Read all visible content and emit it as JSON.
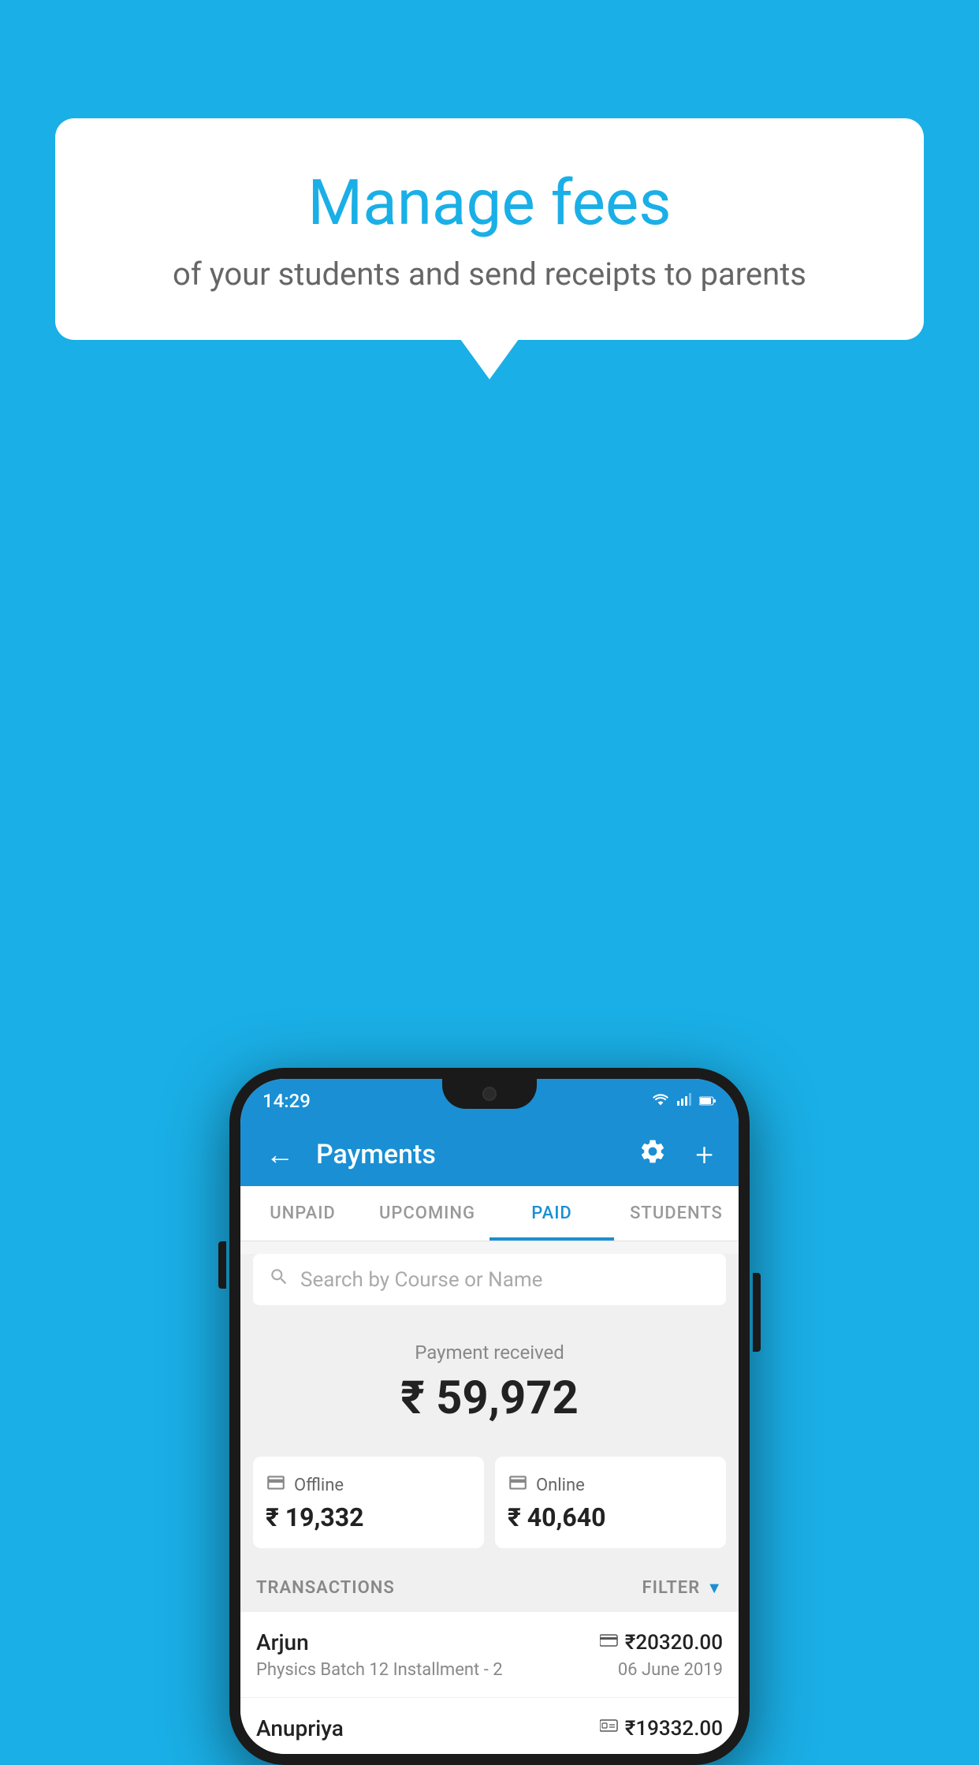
{
  "background_color": "#1AAFE6",
  "speech_bubble": {
    "title": "Manage fees",
    "subtitle": "of your students and send receipts to parents"
  },
  "status_bar": {
    "time": "14:29",
    "wifi": "▲",
    "signal": "▲",
    "battery": "▉"
  },
  "app_bar": {
    "title": "Payments",
    "back_label": "←",
    "gear_label": "⚙",
    "plus_label": "+"
  },
  "tabs": [
    {
      "label": "UNPAID",
      "active": false
    },
    {
      "label": "UPCOMING",
      "active": false
    },
    {
      "label": "PAID",
      "active": true
    },
    {
      "label": "STUDENTS",
      "active": false
    }
  ],
  "search": {
    "placeholder": "Search by Course or Name"
  },
  "payment_summary": {
    "label": "Payment received",
    "amount": "₹ 59,972"
  },
  "payment_cards": [
    {
      "icon": "offline",
      "label": "Offline",
      "amount": "₹ 19,332"
    },
    {
      "icon": "online",
      "label": "Online",
      "amount": "₹ 40,640"
    }
  ],
  "transactions_section": {
    "label": "TRANSACTIONS",
    "filter_label": "FILTER"
  },
  "transactions": [
    {
      "name": "Arjun",
      "amount": "₹20320.00",
      "payment_icon": "card",
      "course": "Physics Batch 12 Installment - 2",
      "date": "06 June 2019"
    },
    {
      "name": "Anupriya",
      "amount": "₹19332.00",
      "payment_icon": "cash",
      "course": "",
      "date": ""
    }
  ]
}
